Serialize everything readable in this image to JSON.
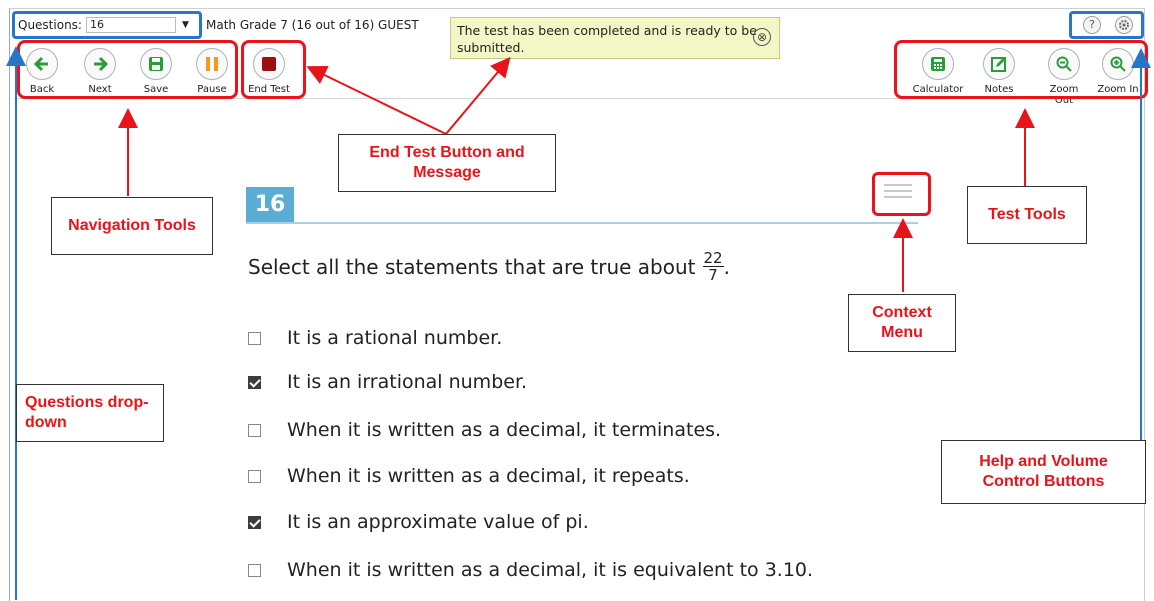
{
  "topbar": {
    "questions_label": "Questions:",
    "questions_value": "16",
    "test_title": "Math Grade 7 (16 out of 16) GUEST",
    "help_icon": "?",
    "settings_icon": "gear-icon"
  },
  "message": {
    "text": "The test has been completed and is ready to be submitted.",
    "close_icon": "⊗"
  },
  "toolbar": {
    "back": "Back",
    "next": "Next",
    "save": "Save",
    "pause": "Pause",
    "end_test": "End Test",
    "calculator": "Calculator",
    "notes": "Notes",
    "zoom_out": "Zoom Out",
    "zoom_in": "Zoom In"
  },
  "colors": {
    "nav_green": "#2e9b3a",
    "pause_orange": "#f39a1e",
    "end_red": "#9b1111",
    "annotation_red": "#e8141a",
    "annotation_blue": "#2776c7",
    "question_blue": "#5aaed6"
  },
  "question": {
    "number": "16",
    "prompt": "Select all the statements that are true about",
    "frac_num": "22",
    "frac_den": "7",
    "prompt_end": ".",
    "options": [
      {
        "text": "It is a rational number.",
        "checked": false
      },
      {
        "text": "It is an irrational number.",
        "checked": true
      },
      {
        "text": "When it is written as a decimal, it terminates.",
        "checked": false
      },
      {
        "text": "When it is written as a decimal, it repeats.",
        "checked": false
      },
      {
        "text": "It is an approximate value of pi.",
        "checked": true
      },
      {
        "text": "When it is written as a decimal, it is equivalent to 3.10.",
        "checked": false
      }
    ]
  },
  "callouts": {
    "navigation": "Navigation Tools",
    "end_test": "End Test Button and Message",
    "test_tools": "Test Tools",
    "context_menu": "Context Menu",
    "questions_dropdown": "Questions drop-down",
    "help_volume": "Help and Volume Control Buttons"
  }
}
